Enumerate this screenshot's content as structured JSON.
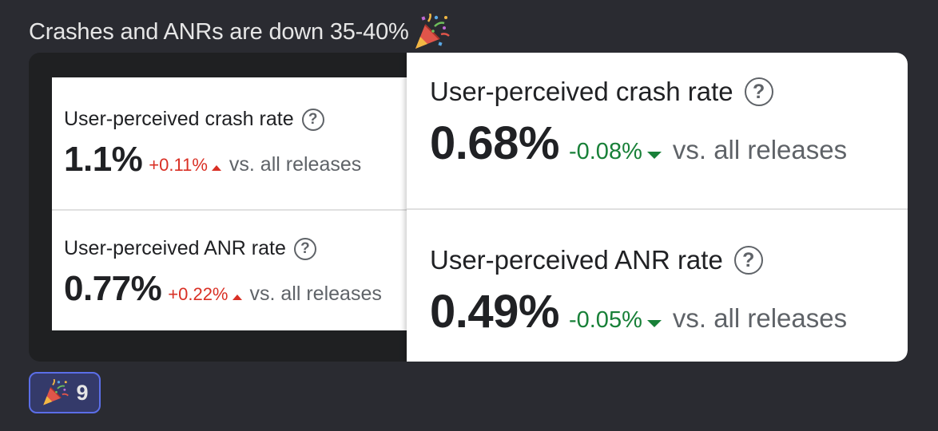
{
  "message": {
    "text": "Crashes and ANRs are down 35-40%",
    "emoji": "party-popper-icon"
  },
  "old_stats": {
    "crash": {
      "label": "User-perceived crash rate",
      "value": "1.1%",
      "delta": "+0.11%",
      "compare": "vs. all releases"
    },
    "anr": {
      "label": "User-perceived ANR rate",
      "value": "0.77%",
      "delta": "+0.22%",
      "compare": "vs. all releases"
    }
  },
  "new_stats": {
    "crash": {
      "label": "User-perceived crash rate",
      "value": "0.68%",
      "delta": "-0.08%",
      "compare": "vs. all releases"
    },
    "anr": {
      "label": "User-perceived ANR rate",
      "value": "0.49%",
      "delta": "-0.05%",
      "compare": "vs. all releases"
    }
  },
  "help_icon_glyph": "?",
  "reaction": {
    "emoji": "party-popper-icon",
    "count": "9"
  },
  "colors": {
    "background": "#2a2b31",
    "delta_up": "#d93025",
    "delta_down": "#188038",
    "reaction_border": "#5b6ee8"
  }
}
